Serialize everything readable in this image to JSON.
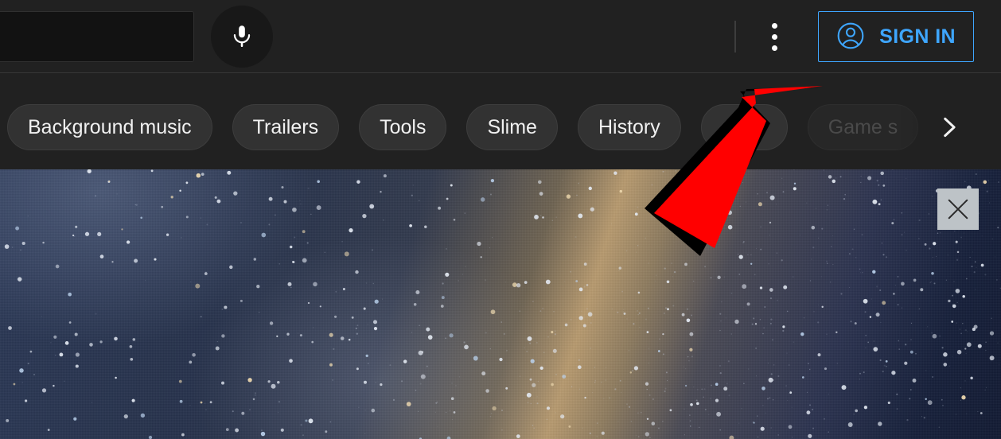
{
  "header": {
    "search": {
      "value": "",
      "placeholder": "",
      "search_icon": "search-icon",
      "mic_icon": "microphone-icon"
    },
    "kebab_icon": "more-vertical-icon",
    "sign_in": {
      "label": "SIGN IN",
      "icon": "account-circle-icon",
      "accent_color": "#3ea6ff"
    }
  },
  "chips": {
    "items": [
      {
        "label": "Background music",
        "faded": false
      },
      {
        "label": "Trailers",
        "faded": false
      },
      {
        "label": "Tools",
        "faded": false
      },
      {
        "label": "Slime",
        "faded": false
      },
      {
        "label": "History",
        "faded": false
      },
      {
        "label": "ghter",
        "faded": false
      },
      {
        "label": "Game s",
        "faded": true
      }
    ],
    "next_icon": "chevron-right-icon"
  },
  "banner": {
    "image_description": "night sky starfield with Milky Way band",
    "close_icon": "close-icon"
  },
  "annotation": {
    "arrow_color": "#ff0000",
    "shadow_color": "#000000",
    "points_to": "SIGN IN"
  }
}
